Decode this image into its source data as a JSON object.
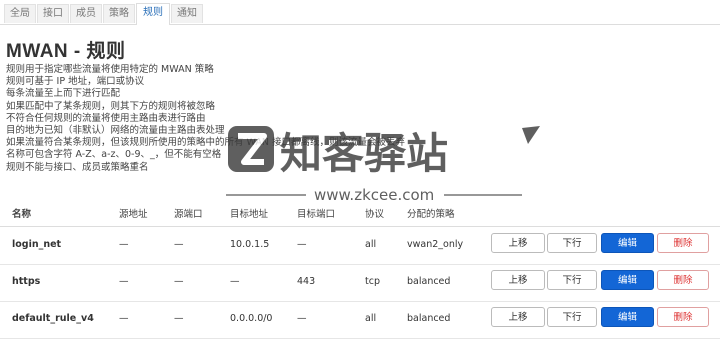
{
  "tabs": [
    {
      "label": "全局"
    },
    {
      "label": "接口"
    },
    {
      "label": "成员"
    },
    {
      "label": "策略"
    },
    {
      "label": "规则"
    },
    {
      "label": "通知"
    }
  ],
  "page": {
    "title": "MWAN - 规则",
    "description": [
      "规则用于指定哪些流量将使用特定的 MWAN 策略",
      "规则可基于 IP 地址，端口或协议",
      "每条流量至上而下进行匹配",
      "如果匹配中了某条规则，则其下方的规则将被忽略",
      "不符合任何规则的流量将使用主路由表进行路由",
      "目的地为已知（非默认）网络的流量由主路由表处理",
      "如果流量符合某条规则，但该规则所使用的策略中的所有 WAN 接口都离线，则该流量会被丢弃",
      "名称可包含字符 A-Z、a-z、0-9、_，但不能有空格",
      "规则不能与接口、成员或策略重名"
    ]
  },
  "watermark": {
    "brand": "知客驿站",
    "url": "www.zkcee.com"
  },
  "table": {
    "headers": [
      "名称",
      "源地址",
      "源端口",
      "目标地址",
      "目标端口",
      "协议",
      "分配的策略"
    ],
    "rows": [
      {
        "name": "login_net",
        "src": "—",
        "sport": "—",
        "dest": "10.0.1.5",
        "dport": "—",
        "proto": "all",
        "policy": "vwan2_only"
      },
      {
        "name": "https",
        "src": "—",
        "sport": "—",
        "dest": "—",
        "dport": "443",
        "proto": "tcp",
        "policy": "balanced"
      },
      {
        "name": "default_rule_v4",
        "src": "—",
        "sport": "—",
        "dest": "0.0.0.0/0",
        "dport": "—",
        "proto": "all",
        "policy": "balanced"
      }
    ],
    "actions": {
      "up": "上移",
      "down": "下行",
      "edit": "编辑",
      "delete": "删除"
    }
  },
  "colors": {
    "accent": "#1366d6",
    "danger": "#dd3333",
    "watermark": "#3c3c3c"
  }
}
